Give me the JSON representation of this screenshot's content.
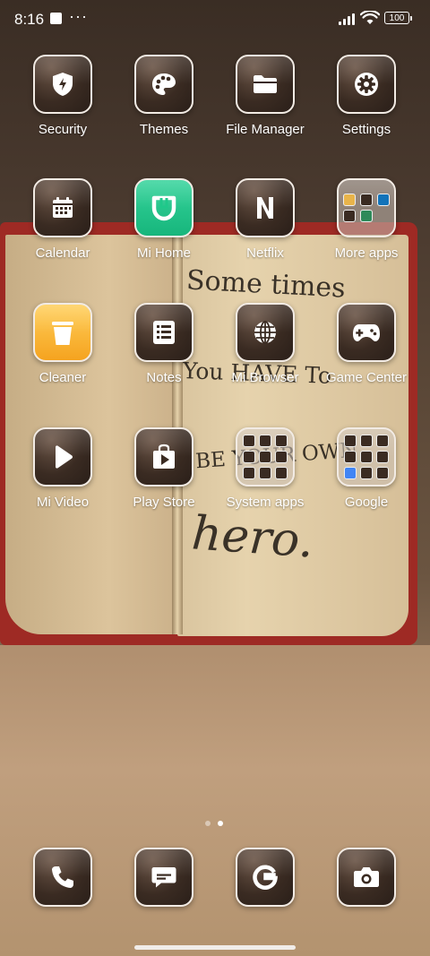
{
  "status_bar": {
    "time": "8:16",
    "overflow": "···",
    "battery": "100"
  },
  "wallpaper": {
    "line1": "Some times",
    "line2": "You HAVE To",
    "line3": "BE YOUR OWN",
    "line4": "hero."
  },
  "apps": [
    {
      "label": "Security",
      "icon": "shield-bolt-icon"
    },
    {
      "label": "Themes",
      "icon": "palette-icon"
    },
    {
      "label": "File Manager",
      "icon": "folder-icon"
    },
    {
      "label": "Settings",
      "icon": "gear-icon"
    },
    {
      "label": "Calendar",
      "icon": "calendar-icon"
    },
    {
      "label": "Mi Home",
      "icon": "mi-home-icon"
    },
    {
      "label": "Netflix",
      "icon": "netflix-icon"
    },
    {
      "label": "More apps",
      "icon": "folder-preview-icon"
    },
    {
      "label": "Cleaner",
      "icon": "trash-icon"
    },
    {
      "label": "Notes",
      "icon": "notes-list-icon"
    },
    {
      "label": "Mi Browser",
      "icon": "globe-icon"
    },
    {
      "label": "Game Center",
      "icon": "gamepad-icon"
    },
    {
      "label": "Mi Video",
      "icon": "play-icon"
    },
    {
      "label": "Play Store",
      "icon": "play-store-bag-icon"
    },
    {
      "label": "System apps",
      "icon": "folder-preview-icon"
    },
    {
      "label": "Google",
      "icon": "folder-preview-icon"
    }
  ],
  "dock": [
    {
      "name": "Phone",
      "icon": "phone-icon"
    },
    {
      "name": "Messages",
      "icon": "message-icon"
    },
    {
      "name": "Chrome",
      "icon": "google-g-icon"
    },
    {
      "name": "Camera",
      "icon": "camera-icon"
    }
  ],
  "page_indicator": {
    "count": 2,
    "active": 2
  },
  "colors": {
    "icon_border": "#f2ebe4",
    "icon_fill": "#3a2b22",
    "mi_home_green": "#1fc88a",
    "cleaner_orange": "#f7b030"
  }
}
